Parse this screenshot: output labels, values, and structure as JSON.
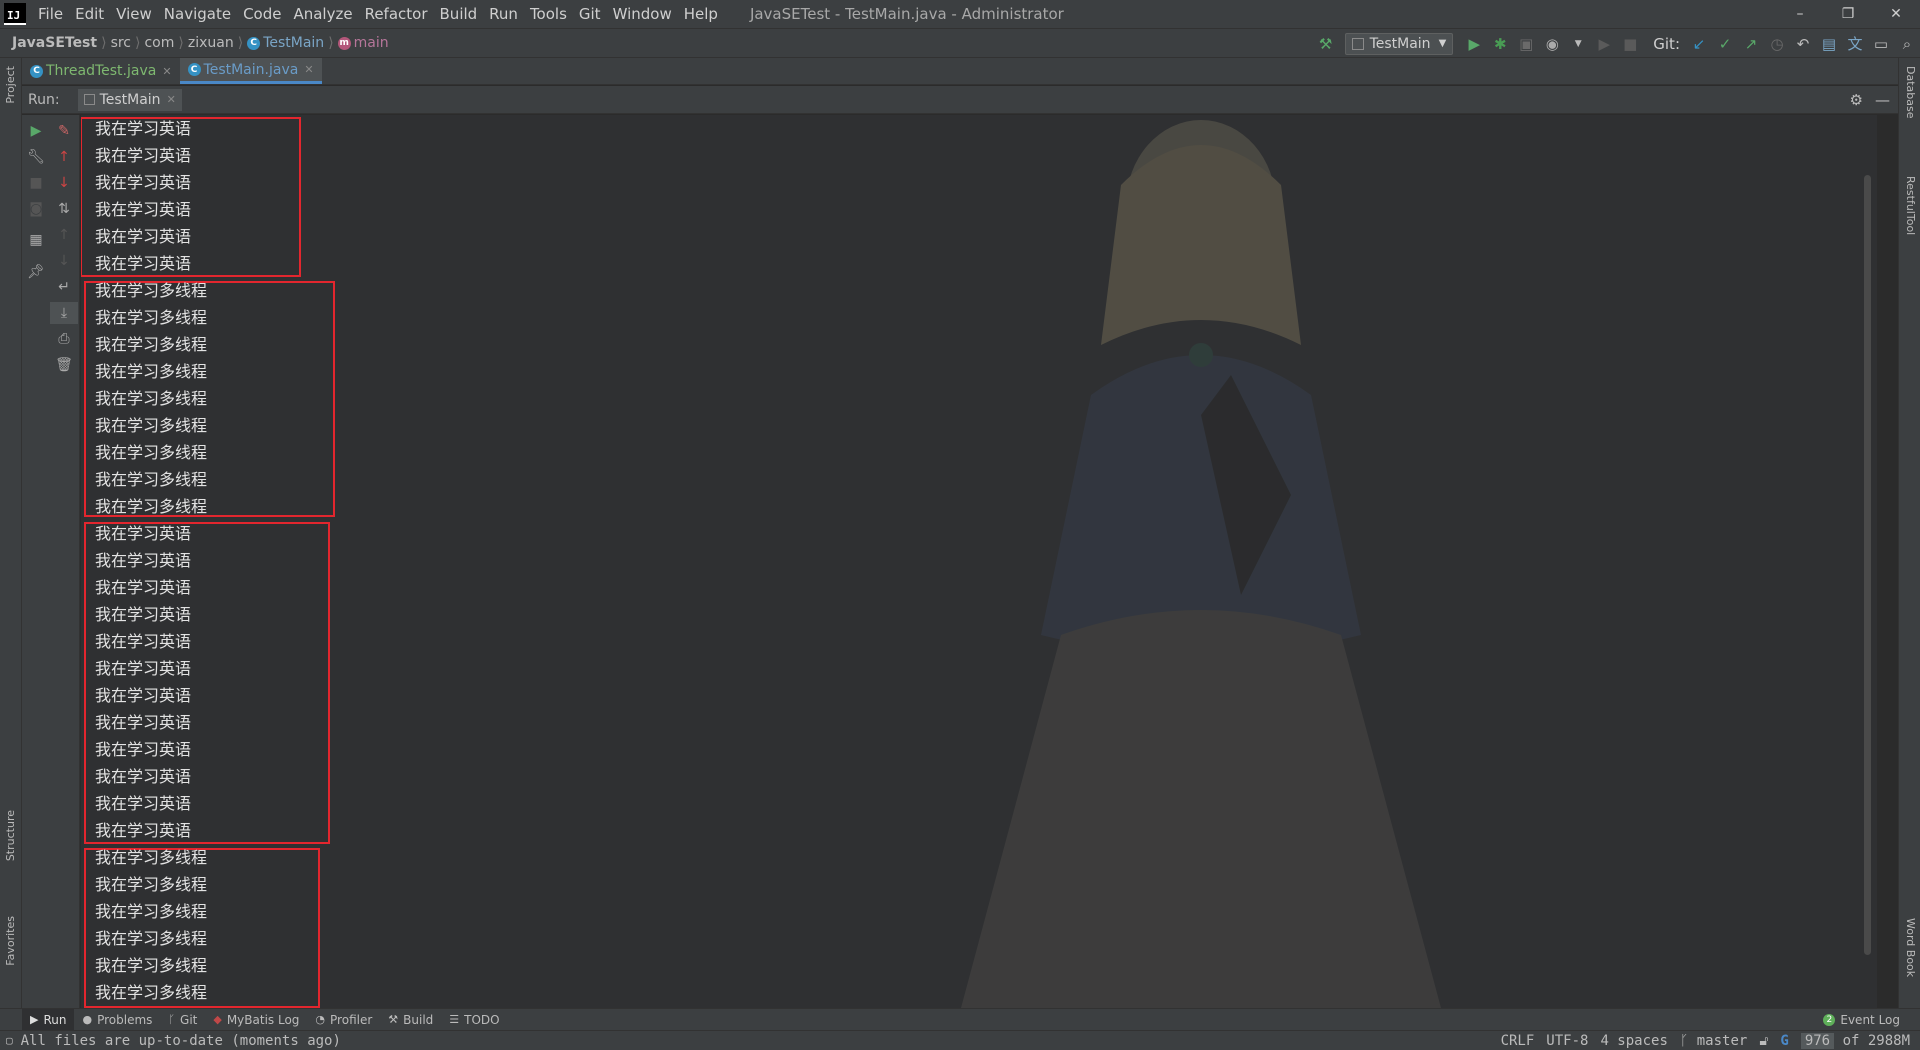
{
  "window": {
    "title": "JavaSETest - TestMain.java - Administrator",
    "controls": {
      "minimize": "–",
      "restore": "❐",
      "close": "✕"
    }
  },
  "menu": [
    "File",
    "Edit",
    "View",
    "Navigate",
    "Code",
    "Analyze",
    "Refactor",
    "Build",
    "Run",
    "Tools",
    "Git",
    "Window",
    "Help"
  ],
  "breadcrumb": {
    "project": "JavaSETest",
    "src": "src",
    "pkg1": "com",
    "pkg2": "zixuan",
    "class": "TestMain",
    "method": "main"
  },
  "toolbar": {
    "run_config": "TestMain",
    "git_label": "Git:"
  },
  "tabs": [
    {
      "label": "ThreadTest.java",
      "active": false
    },
    {
      "label": "TestMain.java",
      "active": true
    }
  ],
  "run_panel": {
    "label": "Run:",
    "tab": "TestMain"
  },
  "console_lines": [
    "我在学习英语",
    "我在学习英语",
    "我在学习英语",
    "我在学习英语",
    "我在学习英语",
    "我在学习英语",
    "我在学习多线程",
    "我在学习多线程",
    "我在学习多线程",
    "我在学习多线程",
    "我在学习多线程",
    "我在学习多线程",
    "我在学习多线程",
    "我在学习多线程",
    "我在学习多线程",
    "我在学习英语",
    "我在学习英语",
    "我在学习英语",
    "我在学习英语",
    "我在学习英语",
    "我在学习英语",
    "我在学习英语",
    "我在学习英语",
    "我在学习英语",
    "我在学习英语",
    "我在学习英语",
    "我在学习英语",
    "我在学习多线程",
    "我在学习多线程",
    "我在学习多线程",
    "我在学习多线程",
    "我在学习多线程",
    "我在学习多线程"
  ],
  "side_strips": {
    "left_top": "Project",
    "left_structure": "Structure",
    "left_favorites": "Favorites",
    "right_database": "Database",
    "right_restful": "RestfulTool",
    "right_wordbook": "Word Book"
  },
  "tool_windows": [
    {
      "label": "Run",
      "icon": "▶",
      "active": true
    },
    {
      "label": "Problems",
      "icon": "●",
      "active": false
    },
    {
      "label": "Git",
      "icon": "ᚴ",
      "active": false
    },
    {
      "label": "MyBatis Log",
      "icon": "◆",
      "active": false
    },
    {
      "label": "Profiler",
      "icon": "◔",
      "active": false
    },
    {
      "label": "Build",
      "icon": "⚒",
      "active": false
    },
    {
      "label": "TODO",
      "icon": "☰",
      "active": false
    }
  ],
  "event_log": {
    "badge": "2",
    "label": "Event Log"
  },
  "status": {
    "message": "All files are up-to-date (moments ago)",
    "line_sep": "CRLF",
    "encoding": "UTF-8",
    "indent": "4 spaces",
    "branch": "master",
    "memory": "976",
    "memory_total": "of 2988M"
  },
  "colors": {
    "highlight_box": "#e3262e",
    "run_green": "#59a869",
    "debug_green": "#499c54",
    "git_blue": "#3592c4"
  }
}
